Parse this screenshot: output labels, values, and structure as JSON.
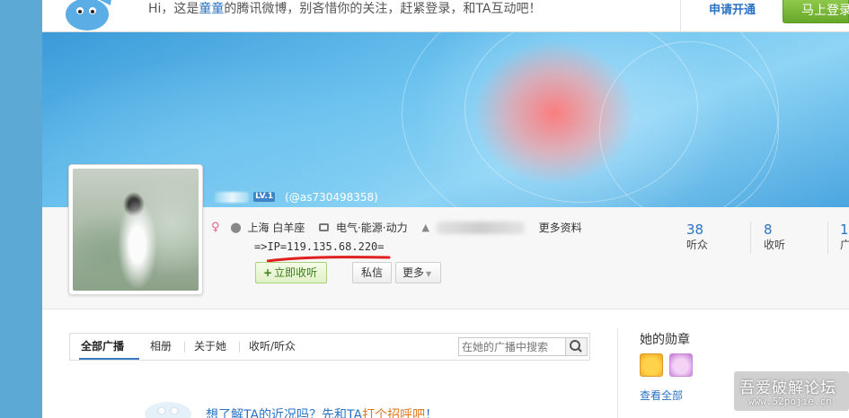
{
  "topbar": {
    "greeting_prefix": "Hi，这是",
    "greeting_name": "童童",
    "greeting_suffix": "的腾讯微博，别吝惜你的关注，赶紧登录，和TA互动吧！",
    "apply_label": "申请开通",
    "login_label": "马上登录"
  },
  "profile": {
    "level_badge": "LV.1",
    "handle": "(@as730498358)",
    "location": "上海 白羊座",
    "occupation": "电气·能源·动力",
    "more_info": "更多资料",
    "ip_text": "=>IP=119.135.68.220=",
    "follow_label": "立即收听",
    "message_label": "私信",
    "more_label": "更多"
  },
  "stats": [
    {
      "num": "38",
      "label": "听众"
    },
    {
      "num": "8",
      "label": "收听"
    },
    {
      "num": "1",
      "label": "广"
    }
  ],
  "tabs": {
    "items": [
      "全部广播",
      "相册",
      "关于她",
      "收听/听众"
    ],
    "active": "全部广播",
    "search_placeholder": "在她的广播中搜索"
  },
  "sidebar": {
    "medal_title": "她的勋章",
    "view_all": "查看全部"
  },
  "bottom_tip": {
    "text": "想了解TA的近况吗？先和TA",
    "highlight": "打个招呼吧",
    "end": "！"
  },
  "watermark": {
    "title": "吾爱破解论坛",
    "url": "www.52pojie.cn"
  },
  "colors": {
    "link_blue": "#2a73c4",
    "login_green": "#66a82a",
    "ip_underline_red": "#e02020",
    "gender_pink": "#e4608a"
  }
}
